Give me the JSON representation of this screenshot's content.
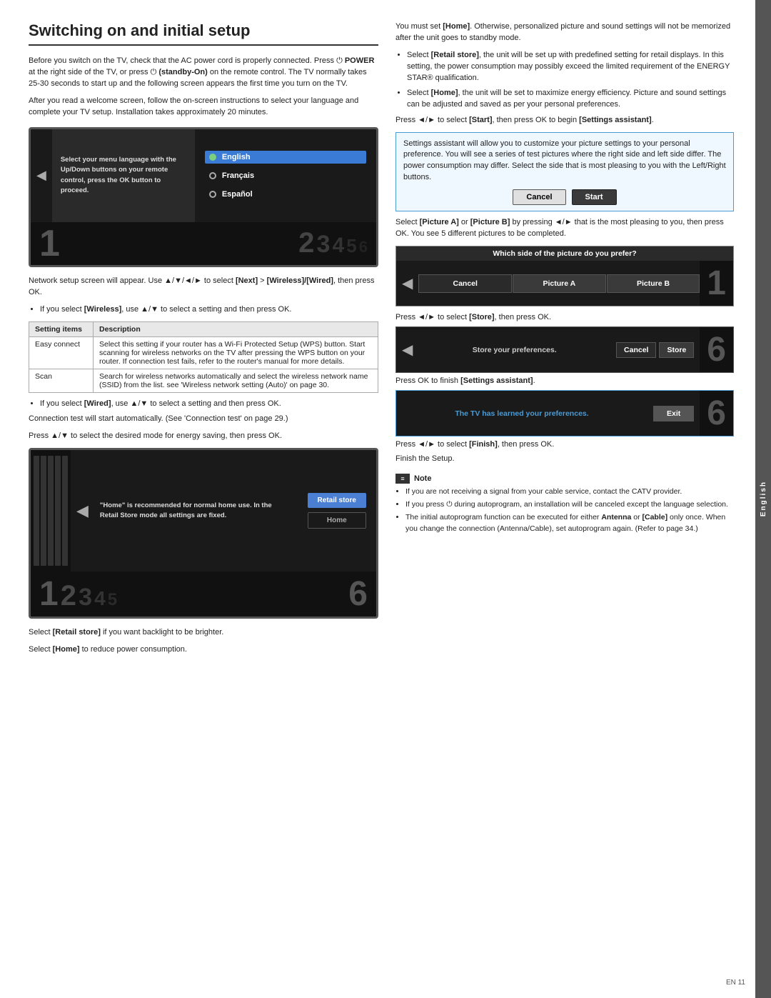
{
  "page": {
    "title": "Switching on and initial setup",
    "side_tab": "English",
    "page_number": "EN  11"
  },
  "left_col": {
    "intro_para1": "Before you switch on the TV, check that the AC power cord is properly connected. Press  POWER at the right side of the TV, or press  (standby-On) on the remote control. The TV normally takes 25-30 seconds to start up and the following screen appears the first time you turn on the TV.",
    "intro_para2": "After you read a welcome screen, follow the on-screen instructions to select your language and complete your TV setup. Installation takes approximately 20 minutes.",
    "tv_menu": {
      "left_text": "Select your menu language with the Up/Down buttons on your remote control, press the OK button to proceed.",
      "languages": [
        "English",
        "Français",
        "Español"
      ],
      "selected": "English"
    },
    "network_para": "Network setup screen will appear. Use ▲/▼/◄/► to select [Next] > [Wireless]/[Wired], then press OK.",
    "wireless_bullet": "If you select [Wireless], use ▲/▼ to select a setting and then press OK.",
    "table": {
      "headers": [
        "Setting items",
        "Description"
      ],
      "rows": [
        {
          "item": "Easy connect",
          "description": "Select this setting if your router has a Wi-Fi Protected Setup (WPS) button. Start scanning for wireless networks on the TV after pressing the WPS button on your router. If connection test fails, refer to the router's manual for more details."
        },
        {
          "item": "Scan",
          "description": "Search for wireless networks automatically and select the wireless network name (SSID) from the list. see 'Wireless network setting (Auto)' on page 30."
        }
      ]
    },
    "wired_bullet": "If you select [Wired], use ▲/▼ to select a setting and then press OK.",
    "connection_test": "Connection test will start automatically. (See 'Connection test' on page 29.)",
    "press_home": "Press ▲/▼ to select the desired mode for energy saving, then press OK.",
    "home_screen": {
      "left_text": "\"Home\" is recommended for normal home use. In the Retail Store mode all settings are fixed.",
      "btn_retail": "Retail store",
      "btn_home": "Home",
      "numbers_left": "12345",
      "number_right": "6"
    },
    "retail_text": "Select [Retail store] if you want backlight to be brighter.",
    "home_text": "Select [Home] to reduce power consumption."
  },
  "right_col": {
    "standby_para": "You must set [Home]. Otherwise, personalized picture and sound settings will not be memorized after the unit goes to standby mode.",
    "retail_bullet": "Select [Retail store], the unit will be set up with predefined setting for retail displays. In this setting, the power consumption may possibly exceed the limited requirement of the ENERGY STAR® qualification.",
    "home_bullet": "Select [Home], the unit will be set to maximize energy efficiency. Picture and sound settings can be adjusted and saved as per your personal preferences.",
    "press_start": "Press ◄/► to select [Start], then press OK to begin [Settings assistant].",
    "settings_box": {
      "text": "Settings assistant will allow you to customize your picture settings to your personal preference. You will see a series of test pictures where the right side and left side differ. The power consumption may differ. Select the side that is most pleasing to you with the Left/Right buttons.",
      "cancel": "Cancel",
      "start": "Start"
    },
    "select_picture": "Select [Picture A] or [Picture B] by pressing ◄/► that is the most pleasing to you, then press OK. You see 5 different pictures to be completed.",
    "picture_box": {
      "header": "Which side of the picture do you prefer?",
      "cancel": "Cancel",
      "picture_a": "Picture A",
      "picture_b": "Picture B"
    },
    "press_store": "Press ◄/► to select [Store], then press OK.",
    "store_box": {
      "header": "Store your preferences.",
      "cancel": "Cancel",
      "store": "Store",
      "number": "6"
    },
    "press_finish_settings": "Press OK to finish [Settings assistant].",
    "learned_box": {
      "header": "The TV has learned your preferences.",
      "exit": "Exit",
      "number": "6"
    },
    "press_finish": "Press ◄/► to select [Finish], then press OK.",
    "finish_setup": "Finish the Setup.",
    "note": {
      "title": "Note",
      "bullets": [
        "If you are not receiving a signal from your cable service, contact the CATV provider.",
        "If you press  during autoprogram, an installation will be canceled except the language selection.",
        "The initial autoprogram function can be executed for either Antenna or Cable only once. When you change the connection (Antenna/Cable), set autoprogram again. (Refer to page 34.)"
      ]
    }
  }
}
